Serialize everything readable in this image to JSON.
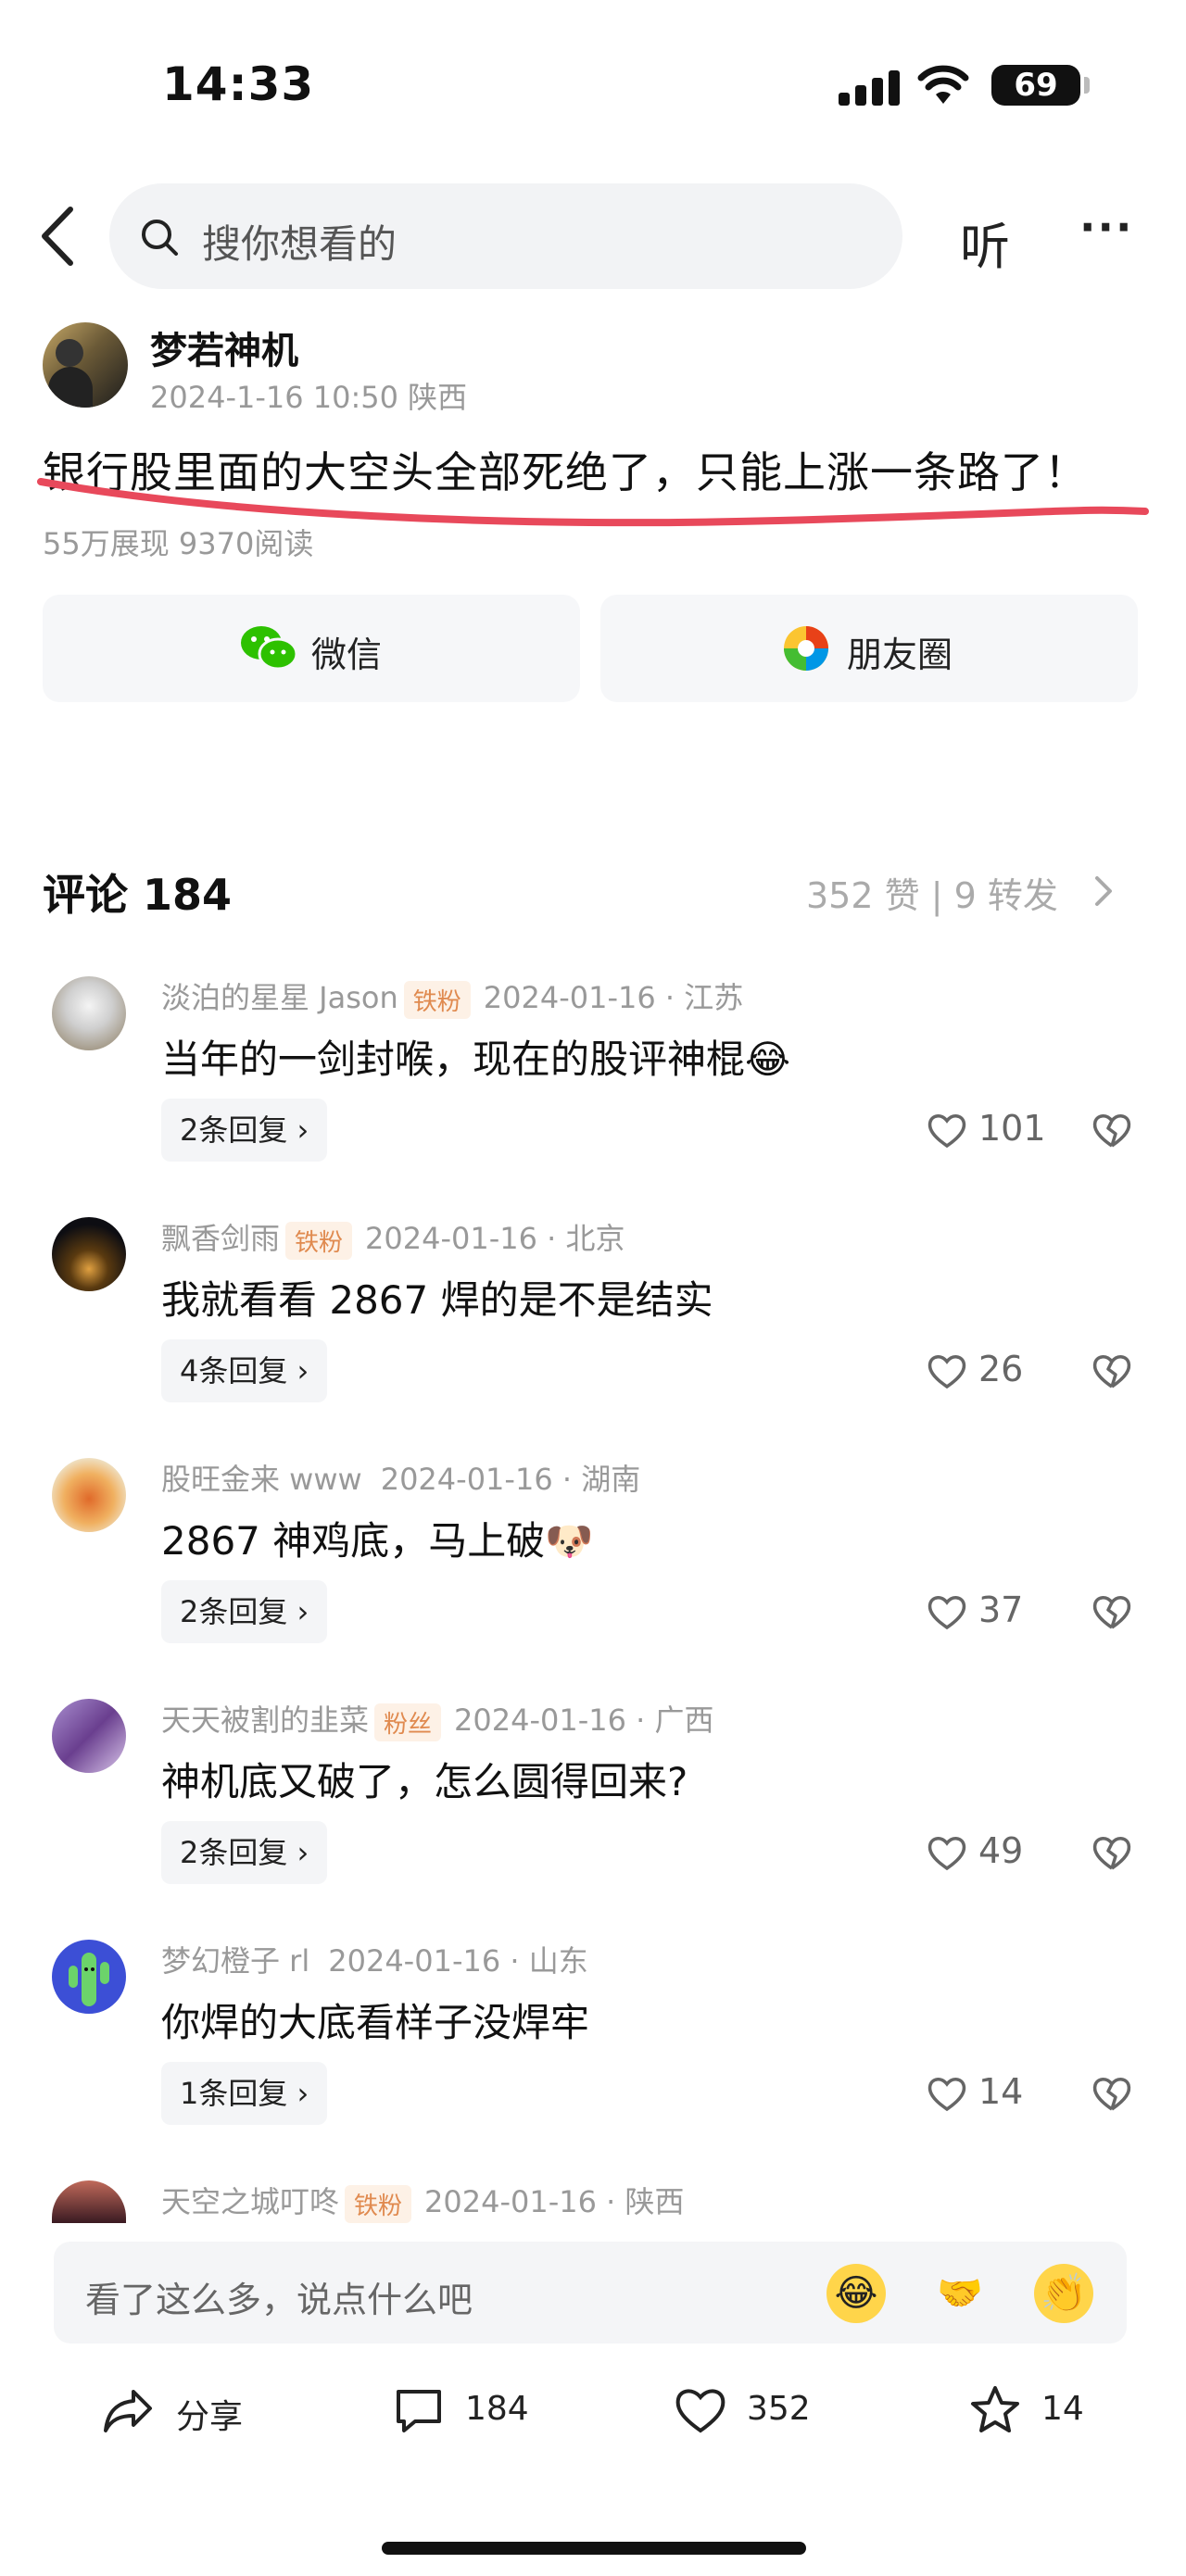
{
  "status_bar": {
    "time": "14:33",
    "battery": "69"
  },
  "nav": {
    "search_placeholder": "搜你想看的",
    "listen_label": "听",
    "more_label": "···"
  },
  "post": {
    "author": "梦若神机",
    "meta": "2024-1-16 10:50  陕西",
    "text": "银行股里面的大空头全部死绝了，只能上涨一条路了！",
    "stats": "55万展现   9370阅读"
  },
  "share": {
    "wechat": "微信",
    "moments": "朋友圈"
  },
  "comments_header": {
    "title": "评论 184",
    "stats": "352 赞  |  9 转发"
  },
  "comments": [
    {
      "name": "淡泊的星星 Jason",
      "badge": "铁粉",
      "meta": "2024-01-16 · 江苏",
      "text": "当年的一剑封喉，现在的股评神棍",
      "emoji": "😂",
      "replies": "2条回复",
      "likes": "101"
    },
    {
      "name": "飘香剑雨",
      "badge": "铁粉",
      "meta": "2024-01-16 · 北京",
      "text": "我就看看 2867 焊的是不是结实",
      "emoji": "",
      "replies": "4条回复",
      "likes": "26"
    },
    {
      "name": "股旺金来 www",
      "badge": "",
      "meta": "2024-01-16 · 湖南",
      "text": "2867 神鸡底，马上破",
      "emoji": "🐶",
      "replies": "2条回复",
      "likes": "37"
    },
    {
      "name": "天天被割的韭菜",
      "badge": "粉丝",
      "meta": "2024-01-16 · 广西",
      "text": "神机底又破了，怎么圆得回来?",
      "emoji": "",
      "replies": "2条回复",
      "likes": "49"
    },
    {
      "name": "梦幻橙子 rl",
      "badge": "",
      "meta": "2024-01-16 · 山东",
      "text": "你焊的大底看样子没焊牢",
      "emoji": "",
      "replies": "1条回复",
      "likes": "14"
    },
    {
      "name": "天空之城叮咚",
      "badge": "铁粉",
      "meta": "2024-01-16 · 陕西"
    }
  ],
  "input": {
    "placeholder": "看了这么多，说点什么吧"
  },
  "bottom_bar": {
    "share": "分享",
    "comments": "184",
    "likes": "352",
    "favorites": "14"
  },
  "colors": {
    "underline": "#e8495b",
    "badge": "#e08a4f",
    "wechat": "#2dc100"
  }
}
